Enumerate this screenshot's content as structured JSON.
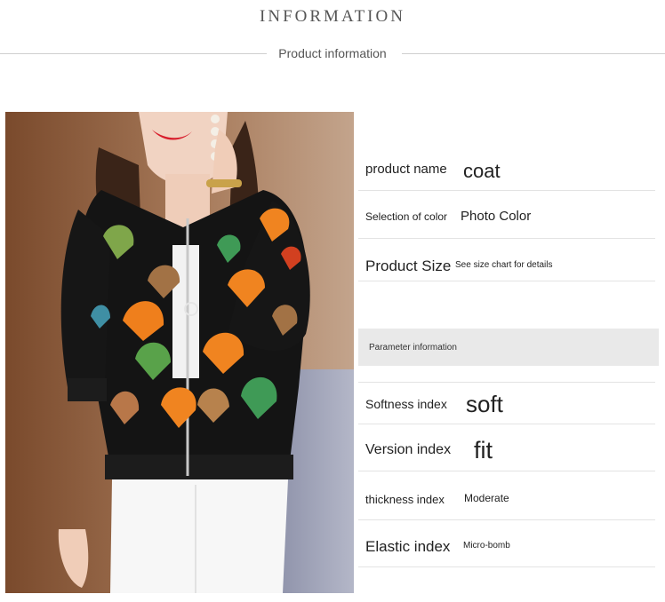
{
  "header": {
    "title": "INFORMATION",
    "subtitle": "Product information"
  },
  "product": {
    "name_label": "product name",
    "name_value": "coat",
    "color_label": "Selection of color",
    "color_value": "Photo Color",
    "size_label": "Product Size",
    "size_value": "See size chart for details"
  },
  "parameters": {
    "section_label": "Parameter information",
    "softness_label": "Softness index",
    "softness_value": "soft",
    "version_label": "Version index",
    "version_value": "fit",
    "thickness_label": "thickness index",
    "thickness_value": "Moderate",
    "elastic_label": "Elastic index",
    "elastic_value": "Micro-bomb"
  }
}
